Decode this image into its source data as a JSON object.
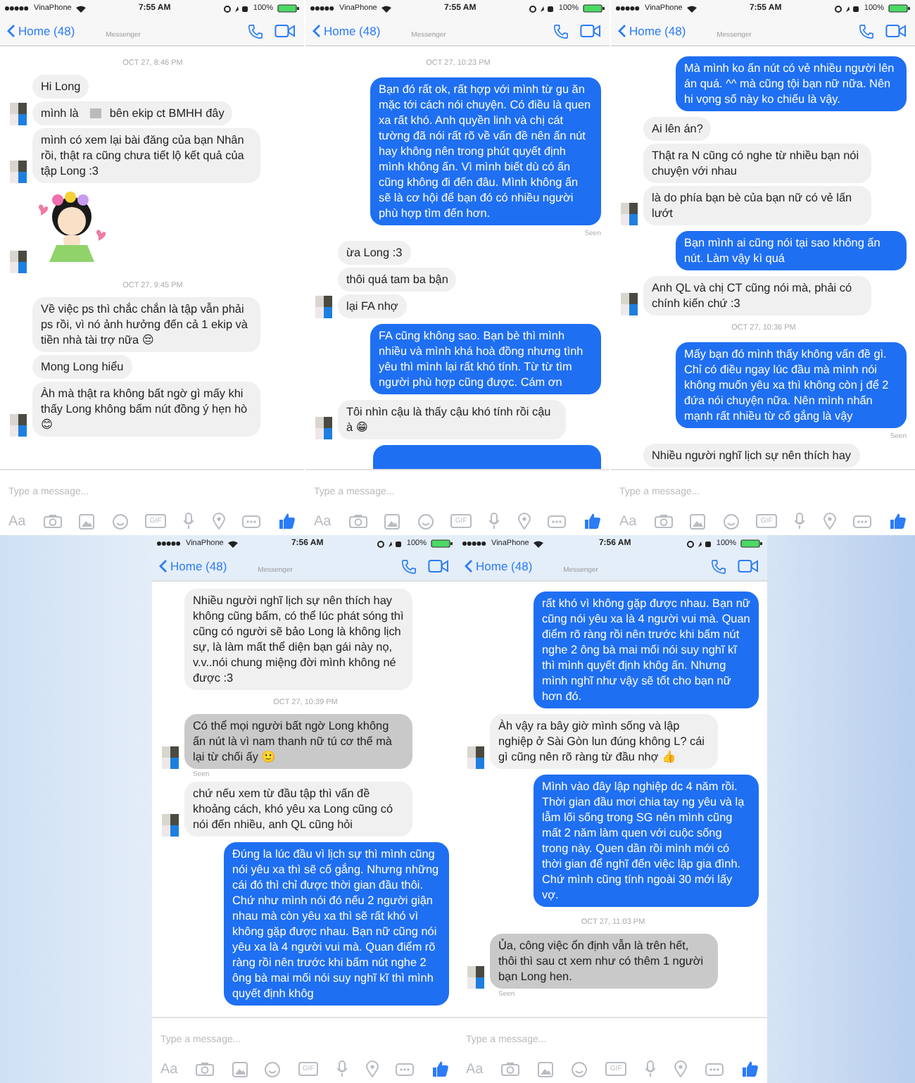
{
  "rows": [
    {
      "panels": [
        {
          "status": {
            "carrier": "VinaPhone",
            "time": "7:55 AM",
            "battery": "100%"
          },
          "nav": {
            "back": "Home (48)",
            "title": "Messenger"
          },
          "messages": [
            {
              "kind": "time",
              "text": "OCT 27, 8:46 PM"
            },
            {
              "kind": "in",
              "text": "Hi Long",
              "avatar": false,
              "highlighted": false
            },
            {
              "kind": "in",
              "text": "mình là",
              "text_after": "bên ekip ct BMHH đây",
              "avatar": true,
              "highlighted": false
            },
            {
              "kind": "in",
              "text": "mình có xem lại bài đăng của bạn Nhân rồi, thật ra cũng chưa tiết lộ kết quả của tập Long :3",
              "avatar": true,
              "highlighted": false
            },
            {
              "kind": "sticker",
              "avatar": true
            },
            {
              "kind": "time",
              "text": "OCT 27, 9:45 PM"
            },
            {
              "kind": "in",
              "text": "Về việc ps thì chắc chắn là tập vẫn phải ps rồi, vì nó ảnh hưởng đến cả 1 ekip và tiền nhà tài trợ nữa 😔",
              "avatar": false,
              "highlighted": false
            },
            {
              "kind": "in",
              "text": "Mong Long hiểu",
              "avatar": false,
              "highlighted": false
            },
            {
              "kind": "in",
              "text": "Àh mà thật ra không bất ngờ gì mấy khi thấy Long không bấm nút đồng ý hẹn hò 😊",
              "avatar": true,
              "highlighted": false
            }
          ],
          "composer": {
            "placeholder": "Type a message...",
            "text_key": "Aa",
            "gif": "GIF"
          }
        },
        {
          "status": {
            "carrier": "VinaPhone",
            "time": "7:55 AM",
            "battery": "100%"
          },
          "nav": {
            "back": "Home (48)",
            "title": "Messenger"
          },
          "messages": [
            {
              "kind": "time",
              "text": "OCT 27, 10:23 PM"
            },
            {
              "kind": "out",
              "text": "Bạn đó rất ok, rất hợp với mình từ gu ăn mặc tới cách nói chuyện. Có điều là quen xa rất khó. Anh quyền linh và chị cát tường đã nói rất rõ về vấn đề nên ấn nút hay không nên trong phút quyết định mình không ấn. Vì mình biết dù có ấn cũng không đi đến đâu. Mình không ấn sẽ là cơ hội để bạn đó có nhiều người phù hợp tìm đến hơn."
            },
            {
              "kind": "seen_out",
              "text": "Seen"
            },
            {
              "kind": "in",
              "text": "ừa Long :3",
              "avatar": false,
              "highlighted": false
            },
            {
              "kind": "in",
              "text": "thôi quá tam ba bận",
              "avatar": false,
              "highlighted": false
            },
            {
              "kind": "in",
              "text": "lại FA nhợ",
              "avatar": true,
              "highlighted": false
            },
            {
              "kind": "out",
              "text": "FA cũng không sao. Bạn bè thì mình nhiều và mình khá hoà đồng nhưng tình yêu thì mình lại rất khó tính. Từ từ tìm người phù hợp cũng được. Cám ơn"
            },
            {
              "kind": "in",
              "text": "Tôi nhìn cậu là thấy cậu khó tính rồi cậu à 😁",
              "avatar": true,
              "highlighted": false
            },
            {
              "kind": "partial"
            }
          ],
          "composer": {
            "placeholder": "Type a message...",
            "text_key": "Aa",
            "gif": "GIF"
          }
        },
        {
          "status": {
            "carrier": "VinaPhone",
            "time": "7:55 AM",
            "battery": "100%"
          },
          "nav": {
            "back": "Home (48)",
            "title": "Messenger"
          },
          "messages": [
            {
              "kind": "out",
              "text": "Mà mình ko ấn nút có vẻ nhiều người lên án quá. ^^ mà cũng tội bạn nữ nữa. Nên hi vọng số này ko chiếu là vậy."
            },
            {
              "kind": "in",
              "text": "Ai lên án?",
              "avatar": false,
              "highlighted": false
            },
            {
              "kind": "in",
              "text": "Thật ra N cũng có nghe từ nhiều bạn nói chuyện với nhau",
              "avatar": false,
              "highlighted": false
            },
            {
              "kind": "in",
              "text": "là do phía bạn bè của bạn nữ có vẻ lấn lướt",
              "avatar": true,
              "highlighted": false
            },
            {
              "kind": "out",
              "text": "Bạn mình ai cũng nói tại sao không ấn nút. Làm vậy kì quá"
            },
            {
              "kind": "in",
              "text": "Anh QL và chị CT cũng nói mà, phải có chính kiến chứ :3",
              "avatar": true,
              "highlighted": false
            },
            {
              "kind": "time",
              "text": "OCT 27, 10:36 PM"
            },
            {
              "kind": "out",
              "text": "Mấy bạn đó mình thấy không vấn đề gì. Chỉ có điều ngay lúc đầu mà mình nói không muốn yêu xa thì không còn j để 2 đứa nói chuyện nữa. Nên mình nhấn mạnh rất nhiều từ cố gắng là vậy"
            },
            {
              "kind": "seen_out",
              "text": "Seen"
            },
            {
              "kind": "in",
              "text": "Nhiều người nghĩ lịch sự nên thích hay",
              "avatar": false,
              "highlighted": false
            }
          ],
          "composer": {
            "placeholder": "Type a message...",
            "text_key": "Aa",
            "gif": "GIF"
          }
        }
      ]
    },
    {
      "panels": [
        {
          "status": {
            "carrier": "VinaPhone",
            "time": "7:56 AM",
            "battery": "100%"
          },
          "nav": {
            "back": "Home (48)",
            "title": "Messenger"
          },
          "messages": [
            {
              "kind": "in",
              "text": "Nhiều người nghĩ lịch sự nên thích hay không cũng bấm, có thể lúc phát sóng thì cũng có người sẽ bảo Long là không lịch sự, là làm mất thể diện bạn gái này nọ, v.v..nói chung miệng đời mình không né được :3",
              "avatar": false,
              "highlighted": false
            },
            {
              "kind": "time",
              "text": "OCT 27, 10:39 PM"
            },
            {
              "kind": "in",
              "text": "Có thể mọi người bất ngờ Long không ấn nút là vì nam thanh nữ tú cơ thế mà lại từ chối ấy 🙂",
              "avatar": true,
              "highlighted": true
            },
            {
              "kind": "seen_in",
              "text": "Seen"
            },
            {
              "kind": "in",
              "text": "chứ nếu xem từ đầu tập thì vấn đề khoảng cách, khó yêu xa Long cũng có nói đến nhiều, anh QL cũng hỏi",
              "avatar": true,
              "highlighted": false
            },
            {
              "kind": "out",
              "text": "Đúng la lúc đầu vì lịch sự thì mình cũng nói yêu xa thì sẽ cố gắng. Nhưng những cái đó thì chỉ được thời gian đầu thôi. Chứ như mình nói đó nếu 2 người giận nhau mà còn yêu xa thì sẽ rất khó vì không gặp được nhau. Bạn nữ cũng nói yêu xa là 4 người vui mà. Quan điểm rõ ràng rồi nên trước khi bấm nút nghe 2 ông bà mai mối nói suy nghĩ kĩ thì mình quyết định khôg"
            }
          ],
          "composer": {
            "placeholder": "Type a message...",
            "text_key": "Aa",
            "gif": "GIF"
          }
        },
        {
          "status": {
            "carrier": "VinaPhone",
            "time": "7:56 AM",
            "battery": "100%"
          },
          "nav": {
            "back": "Home (48)",
            "title": "Messenger"
          },
          "messages": [
            {
              "kind": "out",
              "text": "rất khó vì không gặp được nhau. Bạn nữ cũng nói yêu xa là 4 người vui mà. Quan điểm rõ ràng rồi nên trước khi bấm nút nghe 2 ông bà mai mối nói suy nghĩ kĩ thì mình quyết định khôg ấn. Nhưng mình nghĩ như vậy sẽ tốt cho bạn nữ hơn đó."
            },
            {
              "kind": "in",
              "text": "Àh vậy ra bây giờ mình sống và lập nghiệp ở Sài Gòn lun đúng không  L? cái gì cũng nên rõ ràng từ đầu nhợ 👍",
              "avatar": true,
              "highlighted": false
            },
            {
              "kind": "out",
              "text": "Mình vào đây lập nghiệp dc 4 năm rồi. Thời gian đầu mơi chia tay ng yêu và lạ lẫm lối sống trong SG nên mình cũng mất 2 năm làm quen với cuộc sống trong này. Quen dần rồi mình mới có thời gian để nghĩ đến việc lập gia đình. Chứ mình cũng tính ngoài 30 mới lấy vợ."
            },
            {
              "kind": "time",
              "text": "OCT 27, 11:03 PM"
            },
            {
              "kind": "in",
              "text": "Ủa, công việc ổn định vẫn là trên hết, thôi thì sau ct xem như có thêm 1 người bạn Long hen.",
              "avatar": true,
              "highlighted": true
            },
            {
              "kind": "seen_in",
              "text": "Seen"
            }
          ],
          "composer": {
            "placeholder": "Type a message...",
            "text_key": "Aa",
            "gif": "GIF"
          }
        }
      ]
    }
  ]
}
